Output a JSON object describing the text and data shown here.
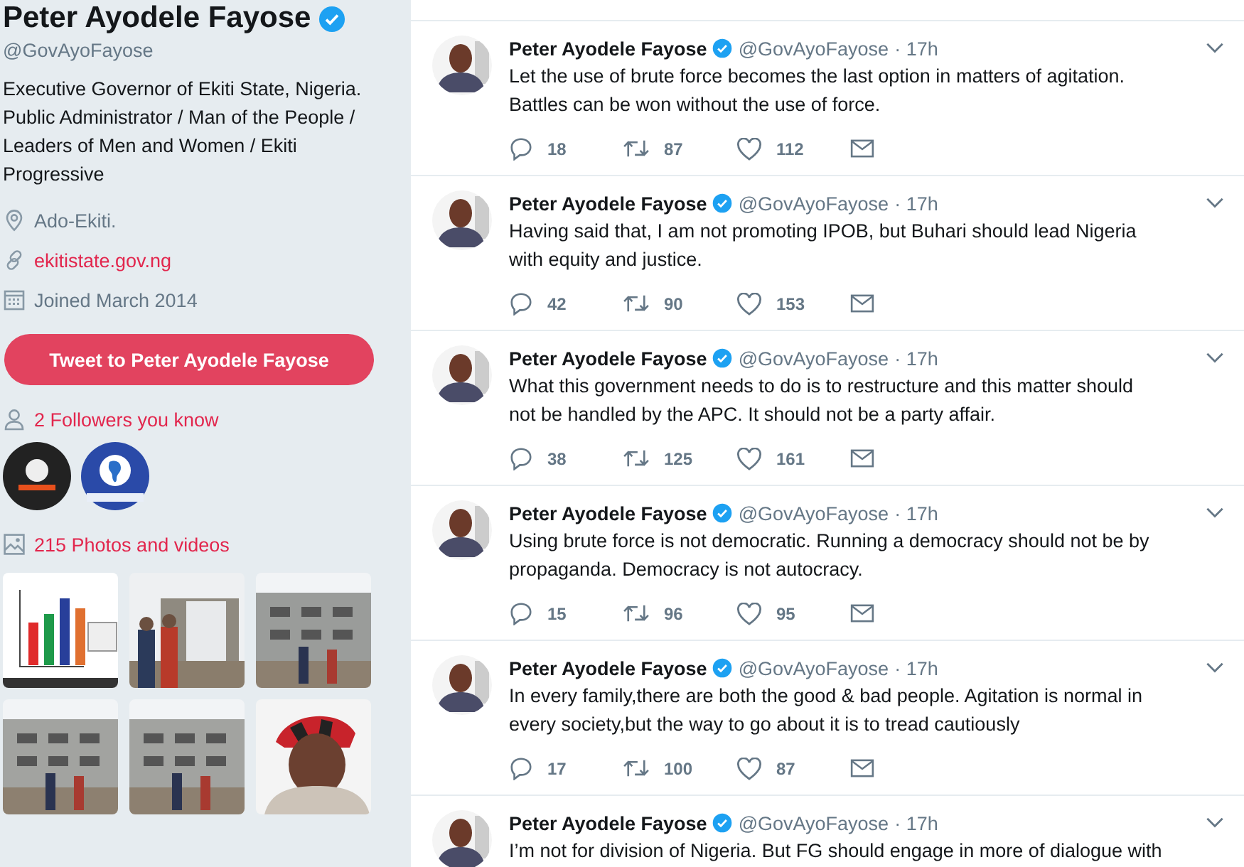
{
  "profile": {
    "name": "Peter Ayodele Fayose",
    "verified": true,
    "handle": "@GovAyoFayose",
    "bio": "Executive Governor of Ekiti State, Nigeria. Public Administrator / Man of the People / Leaders of Men and Women / Ekiti Progressive",
    "location": "Ado-Ekiti.",
    "website": "ekitistate.gov.ng",
    "joined": "Joined March 2014",
    "tweet_button": "Tweet to Peter Ayodele Fayose",
    "followers_you_know": "2 Followers you know",
    "media_link": "215 Photos and videos"
  },
  "media": [
    {
      "kind": "chart"
    },
    {
      "kind": "site"
    },
    {
      "kind": "building"
    },
    {
      "kind": "building"
    },
    {
      "kind": "building"
    },
    {
      "kind": "portrait"
    }
  ],
  "tweets": [
    {
      "name": "Peter Ayodele Fayose",
      "verified": true,
      "handle": "@GovAyoFayose",
      "time": "· 17h",
      "text": "Let the use of brute force becomes the last option in matters of agitation. Battles can be won without the use of force.",
      "replies": "18",
      "retweets": "87",
      "likes": "112"
    },
    {
      "name": "Peter Ayodele Fayose",
      "verified": true,
      "handle": "@GovAyoFayose",
      "time": "· 17h",
      "text": "Having said that, I am not promoting IPOB, but Buhari should lead Nigeria with equity and justice.",
      "replies": "42",
      "retweets": "90",
      "likes": "153"
    },
    {
      "name": "Peter Ayodele Fayose",
      "verified": true,
      "handle": "@GovAyoFayose",
      "time": "· 17h",
      "text": "What this government needs to do is to restructure and this matter should not be handled by the APC. It should not be a party affair.",
      "replies": "38",
      "retweets": "125",
      "likes": "161"
    },
    {
      "name": "Peter Ayodele Fayose",
      "verified": true,
      "handle": "@GovAyoFayose",
      "time": "· 17h",
      "text": "Using brute  force is not democratic. Running a democracy should not be by propaganda. Democracy is not autocracy.",
      "replies": "15",
      "retweets": "96",
      "likes": "95"
    },
    {
      "name": "Peter Ayodele Fayose",
      "verified": true,
      "handle": "@GovAyoFayose",
      "time": "· 17h",
      "text": "In every family,there are both the good & bad people. Agitation is normal in every society,but the way to go about it is to tread cautiously",
      "replies": "17",
      "retweets": "100",
      "likes": "87"
    },
    {
      "name": "Peter Ayodele Fayose",
      "verified": true,
      "handle": "@GovAyoFayose",
      "time": "· 17h",
      "text": "I’m not for division of Nigeria. But FG should engage in more of dialogue with"
    }
  ]
}
